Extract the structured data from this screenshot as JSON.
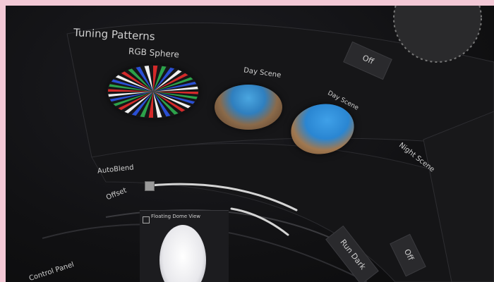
{
  "panel": {
    "title": "Tuning Patterns",
    "patterns": [
      {
        "label": "RGB Sphere"
      },
      {
        "label": "Day Scene"
      },
      {
        "label": "Day Scene"
      },
      {
        "label": "Night Scene"
      }
    ],
    "off_button": "Off"
  },
  "settings": {
    "autoblend_label": "AutoBlend",
    "offset_label": "Offset"
  },
  "floating_view": {
    "title": "Floating Dome View"
  },
  "lower": {
    "control_panel": "Control Panel",
    "run_dark": "Run Dark",
    "off_button": "Off"
  },
  "colors": {
    "panel_bg": "#1a1a1d",
    "button_bg": "#2a2a2d",
    "text": "#cfcfcf"
  }
}
